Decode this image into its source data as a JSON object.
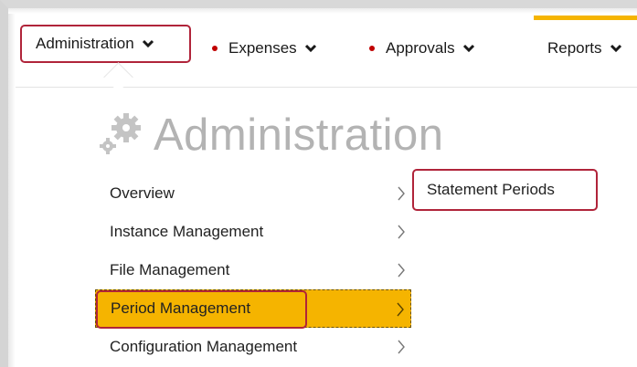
{
  "nav": {
    "administration": "Administration",
    "expenses": "Expenses",
    "approvals": "Approvals",
    "reports": "Reports"
  },
  "page": {
    "title": "Administration"
  },
  "menu": {
    "items": [
      {
        "label": "Overview"
      },
      {
        "label": "Instance Management"
      },
      {
        "label": "File Management"
      },
      {
        "label": "Period Management"
      },
      {
        "label": "Configuration Management"
      }
    ]
  },
  "submenu": {
    "items": [
      {
        "label": "Statement Periods"
      }
    ]
  },
  "colors": {
    "accent": "#f5b400",
    "highlight_border": "#b0243a",
    "dot": "#c00000",
    "title": "#b3b3b3"
  }
}
